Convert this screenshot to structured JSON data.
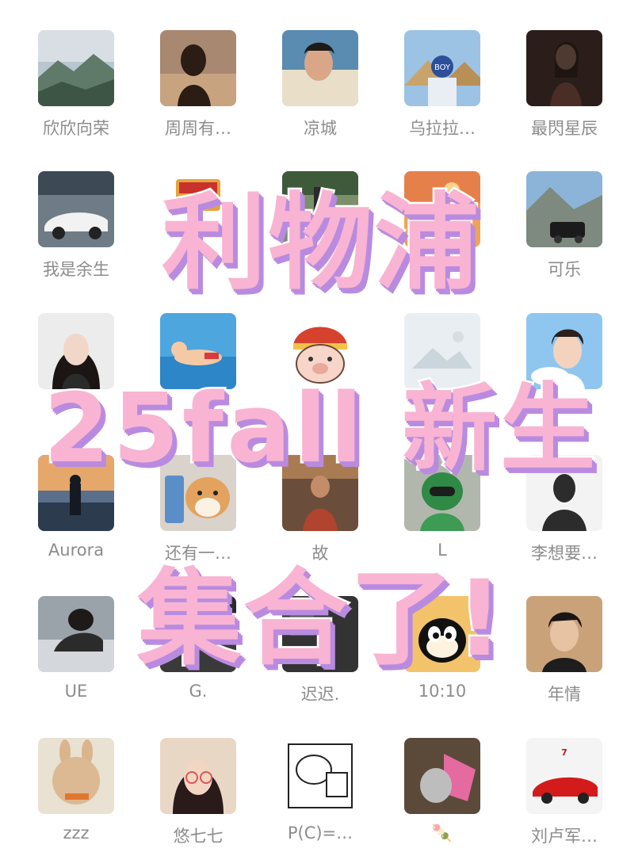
{
  "contacts": [
    {
      "name": "欣欣向荣",
      "avatar": "mountain-landscape"
    },
    {
      "name": "周周有…",
      "avatar": "sunset-silhouette"
    },
    {
      "name": "凉城",
      "avatar": "young-man-portrait"
    },
    {
      "name": "乌拉拉…",
      "avatar": "pyramid-cap"
    },
    {
      "name": "最閃星辰",
      "avatar": "dark-portrait"
    },
    {
      "name": "我是余生",
      "avatar": "sports-car-garage"
    },
    {
      "name": "",
      "avatar": "cartoon-box"
    },
    {
      "name": "",
      "avatar": "park-scene"
    },
    {
      "name": "",
      "avatar": "sunset-sky"
    },
    {
      "name": "可乐",
      "avatar": "mountain-car"
    },
    {
      "name": "",
      "avatar": "girl-portrait"
    },
    {
      "name": "",
      "avatar": "swimming-cartoon"
    },
    {
      "name": "",
      "avatar": "pig-cartoon"
    },
    {
      "name": "",
      "avatar": "placeholder-image"
    },
    {
      "name": "",
      "avatar": "anime-boy"
    },
    {
      "name": "Aurora",
      "avatar": "seaside-silhouette"
    },
    {
      "name": "还有一…",
      "avatar": "shiba-dog"
    },
    {
      "name": "故",
      "avatar": "street-person"
    },
    {
      "name": "L",
      "avatar": "bear-hoodie"
    },
    {
      "name": "李想要…",
      "avatar": "shadow-silhouette"
    },
    {
      "name": "UE",
      "avatar": "writing-man"
    },
    {
      "name": "G.",
      "avatar": "dark-photo"
    },
    {
      "name": "迟迟.",
      "avatar": "dark-room"
    },
    {
      "name": "10:10",
      "avatar": "felix-cat"
    },
    {
      "name": "年情",
      "avatar": "boy-portrait"
    },
    {
      "name": "zzz",
      "avatar": "angry-rabbit"
    },
    {
      "name": "悠七七",
      "avatar": "anime-girl-glasses"
    },
    {
      "name": "P(C)=…",
      "avatar": "sketch-cartoon"
    },
    {
      "name": "🍡",
      "avatar": "cat-pink"
    },
    {
      "name": "刘卢军…",
      "avatar": "red-ferrari"
    }
  ],
  "overlay": {
    "line1": "利物浦",
    "line2": "25fall 新生",
    "line3": "集合了!"
  },
  "colors": {
    "title_fill": "#f8b4d2",
    "title_stroke": "#ffffff",
    "title_shadow": "#b98be0",
    "name_text": "#8c8c8c"
  }
}
